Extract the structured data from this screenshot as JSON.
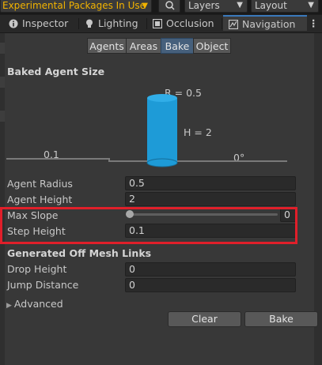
{
  "toolbar": {
    "experimental_packages": "Experimental Packages In Use",
    "layers": "Layers",
    "layout": "Layout"
  },
  "tabs": [
    {
      "label": "Inspector",
      "icon": "info-icon"
    },
    {
      "label": "Lighting",
      "icon": "lightbulb-icon"
    },
    {
      "label": "Occlusion",
      "icon": "occlusion-icon"
    },
    {
      "label": "Navigation",
      "icon": "navigation-icon",
      "active": true
    }
  ],
  "subtabs": [
    "Agents",
    "Areas",
    "Bake",
    "Object"
  ],
  "active_subtab": "Bake",
  "baked_agent_size": {
    "header": "Baked Agent Size",
    "radius_label": "R = 0.5",
    "height_label": "H = 2",
    "step_label": "0.1",
    "slope_label": "0°"
  },
  "fields": {
    "agent_radius": {
      "label": "Agent Radius",
      "value": "0.5"
    },
    "agent_height": {
      "label": "Agent Height",
      "value": "2"
    },
    "max_slope": {
      "label": "Max Slope",
      "value": "0"
    },
    "step_height": {
      "label": "Step Height",
      "value": "0.1"
    }
  },
  "off_mesh": {
    "header": "Generated Off Mesh Links",
    "drop_height": {
      "label": "Drop Height",
      "value": "0"
    },
    "jump_distance": {
      "label": "Jump Distance",
      "value": "0"
    }
  },
  "advanced_label": "Advanced",
  "buttons": {
    "clear": "Clear",
    "bake": "Bake"
  },
  "colors": {
    "accent": "#3a79bb",
    "highlight": "#e01f2a",
    "agent_cylinder": "#1e9bd7",
    "warning_text": "#f2b300"
  }
}
